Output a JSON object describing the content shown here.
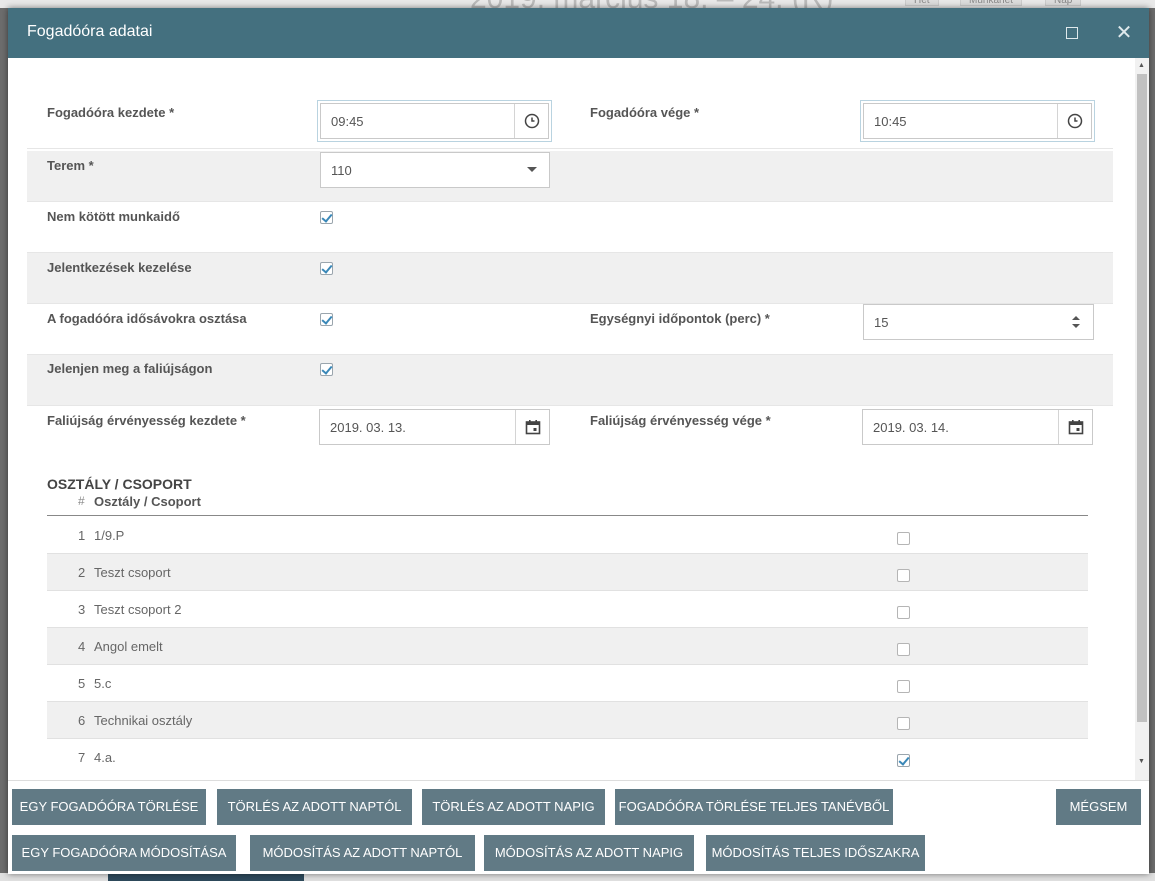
{
  "dialog": {
    "title": "Fogadóóra adatai"
  },
  "form": {
    "start_label": "Fogadóóra kezdete *",
    "start_value": "09:45",
    "end_label": "Fogadóóra vége *",
    "end_value": "10:45",
    "room_label": "Terem *",
    "room_value": "110",
    "unbound_label": "Nem kötött munkaidő",
    "unbound_checked": true,
    "signups_label": "Jelentkezések kezelése",
    "signups_checked": true,
    "slots_label": "A fogadóóra idősávokra osztása",
    "slots_checked": true,
    "unit_label": "Egységnyi időpontok (perc) *",
    "unit_value": "15",
    "board_label": "Jelenjen meg a faliújságon",
    "board_checked": true,
    "board_start_label": "Faliújság érvényesség kezdete *",
    "board_start_value": "2019. 03. 13.",
    "board_end_label": "Faliújság érvényesség vége *",
    "board_end_value": "2019. 03. 14."
  },
  "groups": {
    "section_title": "OSZTÁLY / CSOPORT",
    "col_num": "#",
    "col_name": "Osztály / Csoport",
    "rows": [
      {
        "num": "1",
        "name": "1/9.P",
        "checked": false
      },
      {
        "num": "2",
        "name": "Teszt csoport",
        "checked": false
      },
      {
        "num": "3",
        "name": "Teszt csoport 2",
        "checked": false
      },
      {
        "num": "4",
        "name": "Angol emelt",
        "checked": false
      },
      {
        "num": "5",
        "name": "5.c",
        "checked": false
      },
      {
        "num": "6",
        "name": "Technikai osztály",
        "checked": false
      },
      {
        "num": "7",
        "name": "4.a.",
        "checked": true
      }
    ]
  },
  "buttons": {
    "delete_one": "EGY FOGADÓÓRA TÖRLÉSE",
    "delete_from": "TÖRLÉS AZ ADOTT NAPTÓL",
    "delete_until": "TÖRLÉS AZ ADOTT NAPIG",
    "delete_year": "FOGADÓÓRA TÖRLÉSE TELJES TANÉVBŐL",
    "cancel": "MÉGSEM",
    "modify_one": "EGY FOGADÓÓRA MÓDOSÍTÁSA",
    "modify_from": "MÓDOSÍTÁS AZ ADOTT NAPTÓL",
    "modify_until": "MÓDOSÍTÁS AZ ADOTT NAPIG",
    "modify_all": "MÓDOSÍTÁS TELJES IDŐSZAKRA"
  },
  "colors": {
    "titlebar": "#44707f",
    "button": "#617a85",
    "checkmark": "#3a88b8"
  },
  "icons": {
    "clock": "clock-icon",
    "calendar": "calendar-icon",
    "dropdown": "caret-down-icon",
    "spinner": "spinner-arrows-icon",
    "close": "close-icon",
    "maximize": "maximize-icon"
  }
}
